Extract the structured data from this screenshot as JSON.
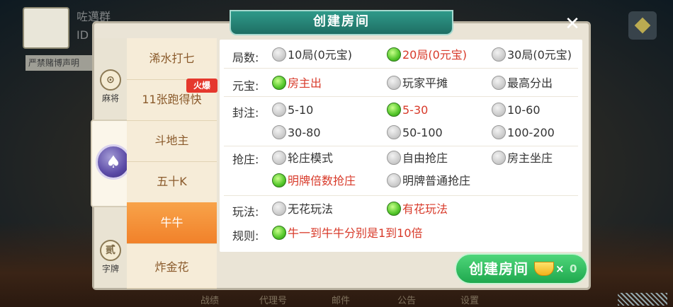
{
  "background": {
    "user_name": "咗邁群",
    "user_id": "ID",
    "notice": "严禁赌博声明",
    "bottom_nav": [
      "战绩",
      "代理号",
      "邮件",
      "公告",
      "设置"
    ]
  },
  "modal": {
    "title": "创建房间",
    "close_label": "✕",
    "categories": [
      {
        "label": "麻将",
        "icon": "mahjong-icon",
        "glyph": "⊙"
      },
      {
        "label": "",
        "icon": "spade-icon",
        "glyph": "♠"
      },
      {
        "label": "字牌",
        "icon": "zipai-icon",
        "glyph": "贰"
      }
    ],
    "games": [
      "浠水打七",
      "11张跑得快",
      "斗地主",
      "五十K",
      "牛牛",
      "炸金花"
    ],
    "active_game": "牛牛",
    "hot_badge": "火爆",
    "rows": {
      "rounds": {
        "label": "局数:",
        "options": [
          "10局(0元宝)",
          "20局(0元宝)",
          "30局(0元宝)"
        ],
        "selected": "20局(0元宝)"
      },
      "ingot": {
        "label": "元宝:",
        "options": [
          "房主出",
          "玩家平摊",
          "最高分出"
        ],
        "selected": "房主出"
      },
      "cap": {
        "label": "封注:",
        "options": [
          "5-10",
          "5-30",
          "10-60",
          "30-80",
          "50-100",
          "100-200"
        ],
        "selected": "5-30"
      },
      "banker": {
        "label": "抢庄:",
        "options": [
          "轮庄模式",
          "自由抢庄",
          "房主坐庄",
          "明牌倍数抢庄",
          "明牌普通抢庄"
        ],
        "selected": "明牌倍数抢庄"
      },
      "play": {
        "label": "玩法:",
        "options": [
          "无花玩法",
          "有花玩法"
        ],
        "selected": "有花玩法"
      },
      "rules": {
        "label": "规则:",
        "options": [
          "牛一到牛牛分别是1到10倍"
        ],
        "selected": "牛一到牛牛分别是1到10倍"
      }
    },
    "create_button": {
      "label": "创建房间",
      "multiplier": "×",
      "count": "0"
    }
  },
  "colors": {
    "accent_green": "#1fa84e",
    "selected_text": "#d83a2a",
    "active_tab": "#f1812a",
    "title_bar": "#1e6e63"
  }
}
